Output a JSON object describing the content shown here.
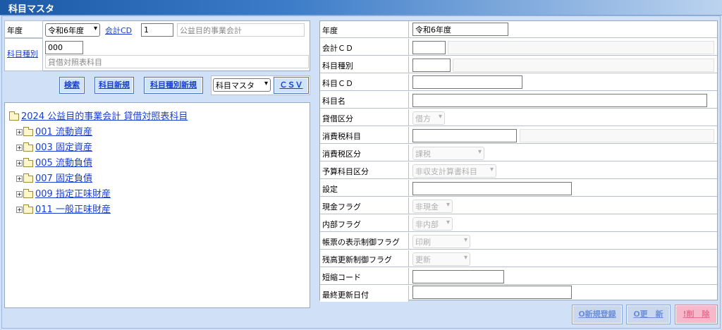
{
  "app": {
    "title": "科目マスタ"
  },
  "left": {
    "nendo_label": "年度",
    "nendo_value": "令和6年度",
    "kaikei_link": "会計CD",
    "kaikei_code": "1",
    "kaikei_name": "公益目的事業会計",
    "shubetsu_link": "科目種別",
    "shubetsu_code": "000",
    "shubetsu_name": "貸借対照表科目",
    "buttons": {
      "search": "検索",
      "new_kamoku": "科目新規",
      "new_shubetsu": "科目種別新規",
      "csv": "ＣＳＶ"
    },
    "csv_select": "科目マスタ"
  },
  "tree": {
    "root": "2024 公益目的事業会計 貸借対照表科目",
    "items": [
      "001 流動資産",
      "003 固定資産",
      "005 流動負債",
      "007 固定負債",
      "009 指定正味財産",
      "011 一般正味財産"
    ]
  },
  "form": {
    "rows": [
      {
        "label": "年度",
        "value": "令和6年度"
      },
      {
        "label": "会計ＣＤ",
        "value": ""
      },
      {
        "label": "科目種別",
        "value": ""
      },
      {
        "label": "科目ＣＤ",
        "value": ""
      },
      {
        "label": "科目名",
        "value": ""
      },
      {
        "label": "貸借区分",
        "select": "借方"
      },
      {
        "label": "消費税科目",
        "value": ""
      },
      {
        "label": "消費税区分",
        "select": "課税"
      },
      {
        "label": "予算科目区分",
        "select": "非収支計算書科目"
      },
      {
        "label": "設定",
        "value": ""
      },
      {
        "label": "現金フラグ",
        "select": "非現金"
      },
      {
        "label": "内部フラグ",
        "select": "非内部"
      },
      {
        "label": "帳票の表示制御フラグ",
        "select": "印刷"
      },
      {
        "label": "残高更新制御フラグ",
        "select": "更新"
      },
      {
        "label": "短縮コード",
        "value": ""
      },
      {
        "label": "最終更新日付",
        "value": ""
      }
    ]
  },
  "footer": {
    "register": "O新規登録",
    "update": "O更　新",
    "delete": "!削　除"
  }
}
